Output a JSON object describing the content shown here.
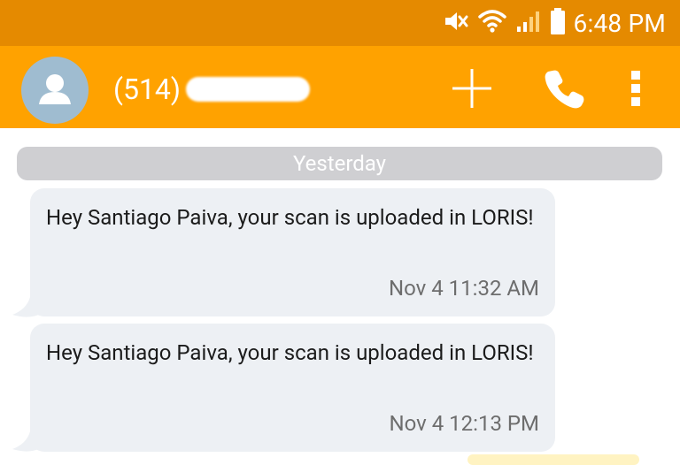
{
  "status_bar": {
    "time": "6:48 PM",
    "icons": [
      "mute-icon",
      "wifi-icon",
      "signal-icon",
      "battery-icon"
    ]
  },
  "app_bar": {
    "contact_prefix": "(514)",
    "actions": [
      "add-icon",
      "phone-icon",
      "overflow-menu-icon"
    ],
    "color": "#ffa200"
  },
  "conversation": {
    "date_separator": "Yesterday",
    "messages": [
      {
        "text": "Hey Santiago Paiva, your scan is uploaded in LORIS!",
        "time": "Nov 4 11:32 AM"
      },
      {
        "text": "Hey Santiago Paiva, your scan is uploaded in LORIS!",
        "time": "Nov 4 12:13 PM"
      }
    ]
  }
}
